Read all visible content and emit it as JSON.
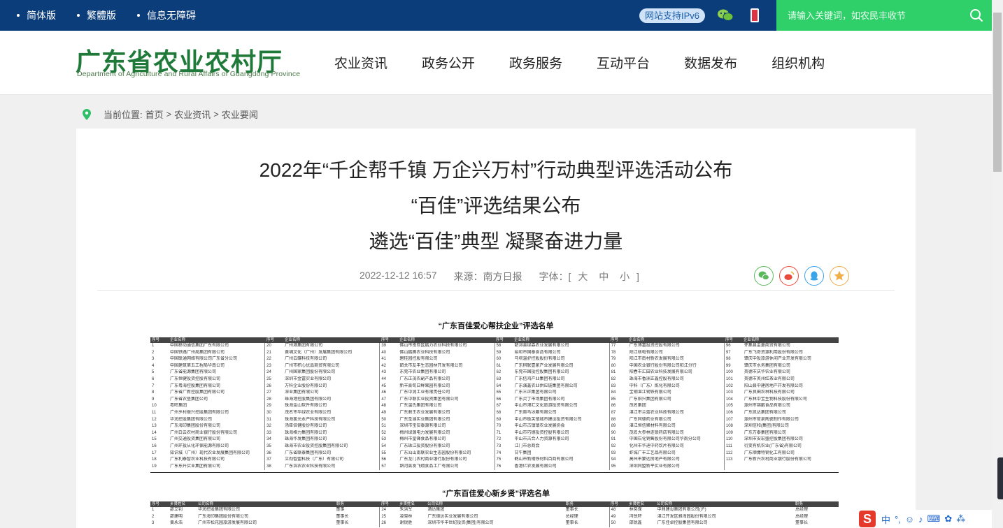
{
  "topbar": {
    "links": [
      {
        "label": "简体版"
      },
      {
        "label": "繁體版"
      },
      {
        "label": "信息无障碍"
      }
    ],
    "ipv6_label": "网站支持IPv6",
    "search": {
      "placeholder": "请输入关键词，如农民丰收节"
    }
  },
  "header": {
    "logo_cn": "广东省农业农村厅",
    "logo_en": "Department of Agriculture and Rural Affairs of Guangdong Province",
    "nav": [
      "农业资讯",
      "政务公开",
      "政务服务",
      "互动平台",
      "数据发布",
      "组织机构"
    ]
  },
  "breadcrumb": {
    "prefix": "当前位置:",
    "items": [
      "首页",
      ">",
      "农业资讯",
      ">",
      "农业要闻"
    ]
  },
  "article": {
    "title_line1": "2022年“千企帮千镇 万企兴万村”行动典型评选活动公布",
    "title_line2": "“百佳”评选结果公布",
    "title_line3": "遴选“百佳”典型 凝聚奋进力量",
    "date": "2022-12-12 16:57",
    "source": "来源：南方日报",
    "font_label": "字体：[",
    "font_big": "大",
    "font_mid": "中",
    "font_small": "小",
    "font_end": "]"
  },
  "tables": {
    "caption1": "“广东百佳爱心帮扶企业”评选名单",
    "caption2": "“广东百佳爱心新乡贤”评选名单",
    "header1": {
      "n": "序号",
      "name": "企业名称"
    },
    "header2": {
      "n": "序号",
      "name": "乡贤姓名",
      "co": "公司名称",
      "job": "职务"
    },
    "col1": [
      [
        "1",
        "中国移动通信集团广东有限公司"
      ],
      [
        "2",
        "中国铁路广州局集团有限公司"
      ],
      [
        "3",
        "中国联通网络有限公司广东省分公司"
      ],
      [
        "4",
        "中国建筑第五工程局华南公司"
      ],
      [
        "5",
        "广东省能源集团有限公司"
      ],
      [
        "6",
        "广东恒健投资控股有限公司"
      ],
      [
        "7",
        "广东粤海控股集团有限公司"
      ],
      [
        "8",
        "广东省广新控股集团有限公司"
      ],
      [
        "9",
        "广东省农垦集团公司"
      ],
      [
        "10",
        "粤旺集团"
      ],
      [
        "11",
        "广州乡村振兴控股集团有限公司"
      ],
      [
        "12",
        "华润控股集团有限公司"
      ],
      [
        "13",
        "广东海印集团股份有限公司"
      ],
      [
        "14",
        "广州白云农村商业银行股份有限公司"
      ],
      [
        "15",
        "广州交通投资集团有限公司"
      ],
      [
        "16",
        "广州环投从化环保能源有限公司"
      ],
      [
        "17",
        "知识城（广州）现代农业发展集团有限公司"
      ],
      [
        "18",
        "广东利泰智农业科技有限公司"
      ],
      [
        "19",
        "广东东升实业集团有限公司"
      ]
    ],
    "col2": [
      [
        "20",
        "广州港集团有限公司"
      ],
      [
        "21",
        "黄埔文化（广州）发展集团有限公司"
      ],
      [
        "22",
        "广州云蝶科技有限公司"
      ],
      [
        "23",
        "广州市积心优品商贸有限公司"
      ],
      [
        "24",
        "广州国家集团股份有限公司"
      ],
      [
        "25",
        "深圳市金富实业有限公司"
      ],
      [
        "26",
        "万科企业股份有限公司"
      ],
      [
        "27",
        "深业集团有限公司"
      ],
      [
        "28",
        "珠海港控股集团有限公司"
      ],
      [
        "29",
        "珠海金山软件有限公司"
      ],
      [
        "30",
        "茂名市华绿农业有限公司"
      ],
      [
        "31",
        "珠海氯元永产科技有限公司"
      ],
      [
        "32",
        "汤臣倍健股份有限公司"
      ],
      [
        "33",
        "珠海格力集团有限公司"
      ],
      [
        "34",
        "珠海华发集团有限公司"
      ],
      [
        "35",
        "珠海市农业投资控股集团有限公司"
      ],
      [
        "36",
        "广东省联泰集团有限公司"
      ],
      [
        "37",
        "立劲智盟科技（广东）有限公司"
      ],
      [
        "38",
        "广东浩农农业科技有限公司"
      ]
    ],
    "col3": [
      [
        "39",
        "佛山市南亚区鹏力农业科技有限公司"
      ],
      [
        "40",
        "佛山鹏腾农业科技有限公司"
      ],
      [
        "41",
        "碧桂园控股有限公司"
      ],
      [
        "42",
        "韶关市友丰生态园林开发有限公司"
      ],
      [
        "43",
        "东莞市农业集团有限公司"
      ],
      [
        "44",
        "广东正茂农副产品有限公司"
      ],
      [
        "45",
        "新丰县旬日鲜果园有限公司"
      ],
      [
        "46",
        "广东中润工业有限责任公司"
      ],
      [
        "47",
        "广东中联实业投资集团有限公司"
      ],
      [
        "48",
        "广东温氏集团有限公司"
      ],
      [
        "49",
        "广东鼎王农业发展有限公司"
      ],
      [
        "50",
        "广东圣湖实业集团有限公司"
      ],
      [
        "51",
        "深圳市宝安泰源有限公司"
      ],
      [
        "52",
        "梅州绿源电力发展有限公司"
      ],
      [
        "53",
        "梅州市皇锋食品有限公司"
      ],
      [
        "54",
        "广东珠江投资股份有限公司"
      ],
      [
        "55",
        "广东汕山南联农业生态园股份有限公司"
      ],
      [
        "56",
        "广东龙门农村商业银行股份有限公司"
      ],
      [
        "57",
        "韶河县发飞翔食品工厂有限公司"
      ]
    ],
    "col4": [
      [
        "58",
        "韶浔县绿森农业发展有限公司"
      ],
      [
        "59",
        "始和市国泰食品有限公司"
      ],
      [
        "60",
        "马坝温驴控股股份有限公司"
      ],
      [
        "61",
        "广东棋联壹家产业发展有限公司"
      ],
      [
        "62",
        "东莞市国投控股集团有限公司"
      ],
      [
        "63",
        "广东信鸿产业集团有限公司"
      ],
      [
        "64",
        "广东演鑫农业供应链集团有限公司"
      ],
      [
        "65",
        "广东三正集团有限公司"
      ],
      [
        "66",
        "广东灵丁市场集团有限公司"
      ],
      [
        "67",
        "中山市港汇文化旅游投资有限公司"
      ],
      [
        "68",
        "广东奥马冰箱有限公司"
      ],
      [
        "69",
        "中山市板芙镇城市建设投资有限公司"
      ],
      [
        "70",
        "中山市古镇镇农业发展协会"
      ],
      [
        "71",
        "中山市巧德投资控股有限公司"
      ],
      [
        "72",
        "中山市古合人力资源有限公司"
      ],
      [
        "73",
        "江门市总商会"
      ],
      [
        "74",
        "甘牛集团"
      ],
      [
        "75",
        "鹤山市新钢铁材料百商有限公司"
      ],
      [
        "76",
        "香港亿农发展有限公司"
      ]
    ],
    "col5": [
      [
        "77",
        "广东博富投资控股有限公司"
      ],
      [
        "78",
        "阳江核电有限公司"
      ],
      [
        "79",
        "阳江市南村新农发展有限公司"
      ],
      [
        "80",
        "中国农业银行股份有限公司阳江分行"
      ],
      [
        "81",
        "阳春市汇田农业科技发展有限公司"
      ],
      [
        "82",
        "珠海市香洲正鑫控股有限公司"
      ],
      [
        "83",
        "中科（广东）炼化有限公司"
      ],
      [
        "84",
        "宝钢湛江钢铁有限公司"
      ],
      [
        "85",
        "广东阳兴集团有限公司"
      ],
      [
        "86",
        "茂名集团"
      ],
      [
        "87",
        "湛江市兰蓝农业科技有限公司"
      ],
      [
        "88",
        "广东同德药业有限公司"
      ],
      [
        "89",
        "湛江恒信聚材料有限公司"
      ],
      [
        "90",
        "茂名大参林连锁药店有限公司"
      ],
      [
        "91",
        "中国石化销售股份有限公司华南分公司"
      ],
      [
        "92",
        "化州市华迪中药饮片有限公司"
      ],
      [
        "93",
        "虾城广丰工艺品有限公司"
      ],
      [
        "94",
        "高州市蒙达房地产有限公司"
      ],
      [
        "95",
        "深圳同盟新平实业有限公司"
      ]
    ],
    "col6": [
      [
        "96",
        "怀集县金菱商贸有限公司"
      ],
      [
        "97",
        "广东飞奇资源利用股份有限公司"
      ],
      [
        "98",
        "肇庆中投旅游休闲产业开发有限公司"
      ],
      [
        "99",
        "肇庆市水务集团有限公司"
      ],
      [
        "100",
        "英德市庆华农业有限公司"
      ],
      [
        "101",
        "英德市英州红茶业有限公司"
      ],
      [
        "102",
        "阳山县中建房地产开发有限公司"
      ],
      [
        "103",
        "广东良田农林科技有限公司"
      ],
      [
        "104",
        "广东林中宝生物科技股份有限公司"
      ],
      [
        "105",
        "潮州市锦鹏食品有限公司"
      ],
      [
        "106",
        "广东凯达集团有限公司"
      ],
      [
        "107",
        "潮州市荷泉陶瓷制作有限公司"
      ],
      [
        "108",
        "深圳信和(集团)有限公司"
      ],
      [
        "109",
        "广东万泰集团有限公司"
      ],
      [
        "110",
        "深圳市安宏盛控股集团有限公司"
      ],
      [
        "111",
        "衍变有机农业(广东省)有限公司"
      ],
      [
        "112",
        "广东顺慷特钢化工有限公司"
      ],
      [
        "113",
        "广东新兴农村商业银行股份有限公司"
      ]
    ],
    "t2_rows": [
      {
        "a": [
          "1",
          "邵立钊",
          "华润控股集团有限公司",
          "董事"
        ],
        "b": [
          "24",
          "朱洪军",
          "酒达集团",
          "董事长"
        ],
        "c": [
          "48",
          "林奕保",
          "中鼎建设集团有限公司(沪)",
          "总经理"
        ]
      },
      {
        "a": [
          "2",
          "邵建明",
          "广东海印集团股份有限公司",
          "董事长"
        ],
        "b": [
          "25",
          "凌晓林",
          "广东德达实业发展有限公司",
          "总经理"
        ],
        "c": [
          "49",
          "冯锐轩",
          "湛江开发区雅海园股份有限公司",
          "总经理"
        ]
      },
      {
        "a": [
          "3",
          "黄永浩",
          "广州市松花园旅游发展有限公司",
          "董事长"
        ],
        "b": [
          "26",
          "谢锐胜",
          "深圳市华丰世纪投资(集团)有限公司",
          "董事长"
        ],
        "c": [
          "50",
          "邵锐鑫",
          "广东佳卓控股集团有限公司",
          "董事长"
        ]
      }
    ]
  }
}
